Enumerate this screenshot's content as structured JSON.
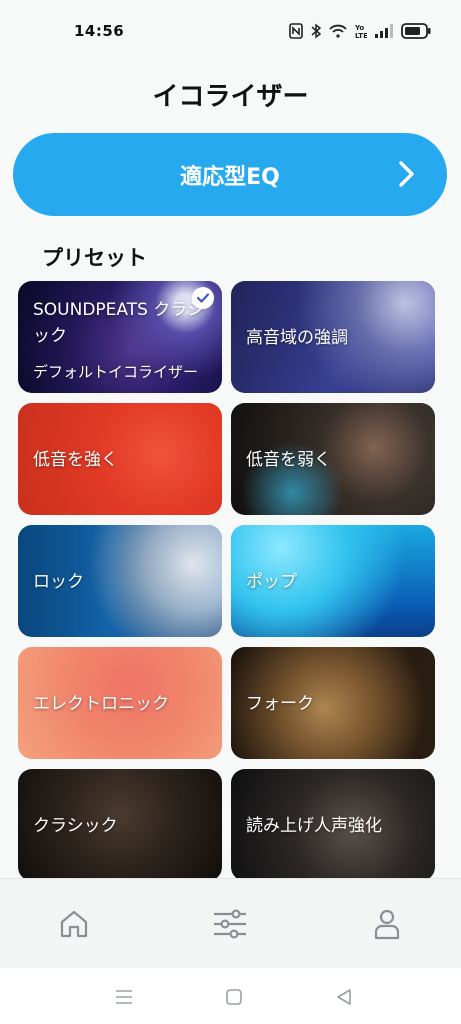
{
  "status": {
    "time": "14:56",
    "icons": [
      "nfc-icon",
      "bluetooth-icon",
      "wifi-icon",
      "volte-icon",
      "signal-icon",
      "battery-icon"
    ]
  },
  "page": {
    "title": "イコライザー"
  },
  "eq": {
    "label": "適応型EQ",
    "icon": "chevron-right-icon",
    "color": "#27a9f0"
  },
  "presets": {
    "title": "プリセット",
    "items": [
      {
        "label": "SOUNDPEATS クラシック",
        "sub": "デフォルトイコライザー",
        "selected": true
      },
      {
        "label": "高音域の強調"
      },
      {
        "label": "低音を強く"
      },
      {
        "label": "低音を弱く"
      },
      {
        "label": "ロック"
      },
      {
        "label": "ポップ"
      },
      {
        "label": "エレクトロニック"
      },
      {
        "label": "フォーク"
      },
      {
        "label": "クラシック"
      },
      {
        "label": "読み上げ人声強化"
      }
    ]
  },
  "nav": {
    "items": [
      "home-icon",
      "equalizer-icon",
      "profile-icon"
    ],
    "active": "equalizer-icon"
  },
  "system_nav": [
    "menu-icon",
    "home-square-icon",
    "back-icon"
  ]
}
